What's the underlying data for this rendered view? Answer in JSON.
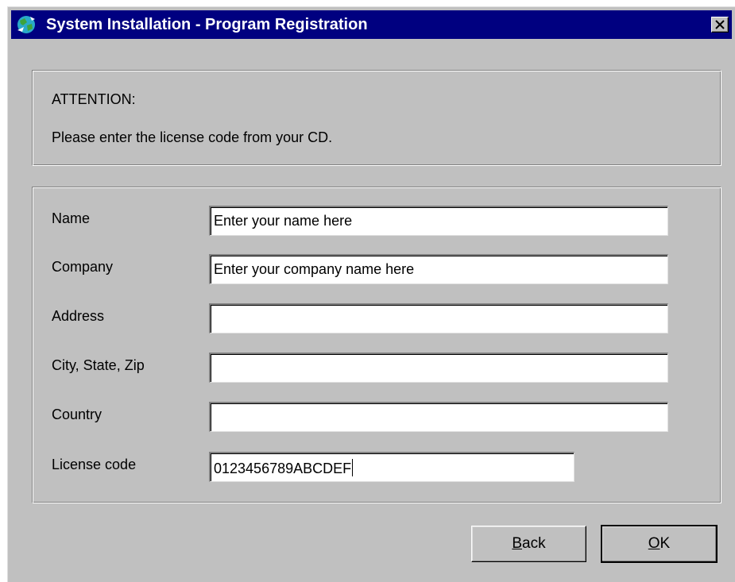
{
  "window": {
    "title": "System Installation - Program Registration",
    "close_glyph": "×"
  },
  "attention": {
    "heading": "ATTENTION:",
    "message": "Please enter the license code from your CD."
  },
  "form": {
    "fields": [
      {
        "label": "Name",
        "value": "Enter your name here"
      },
      {
        "label": "Company",
        "value": "Enter your company  name here"
      },
      {
        "label": "Address",
        "value": ""
      },
      {
        "label": "City, State, Zip",
        "value": ""
      },
      {
        "label": "Country",
        "value": ""
      },
      {
        "label": "License code",
        "value": "0123456789ABCDEF"
      }
    ]
  },
  "buttons": {
    "back": {
      "mnemonic": "B",
      "rest": "ack"
    },
    "ok": {
      "mnemonic": "O",
      "rest": "K"
    }
  },
  "colors": {
    "titlebar": "#000080",
    "face": "#c0c0c0"
  }
}
